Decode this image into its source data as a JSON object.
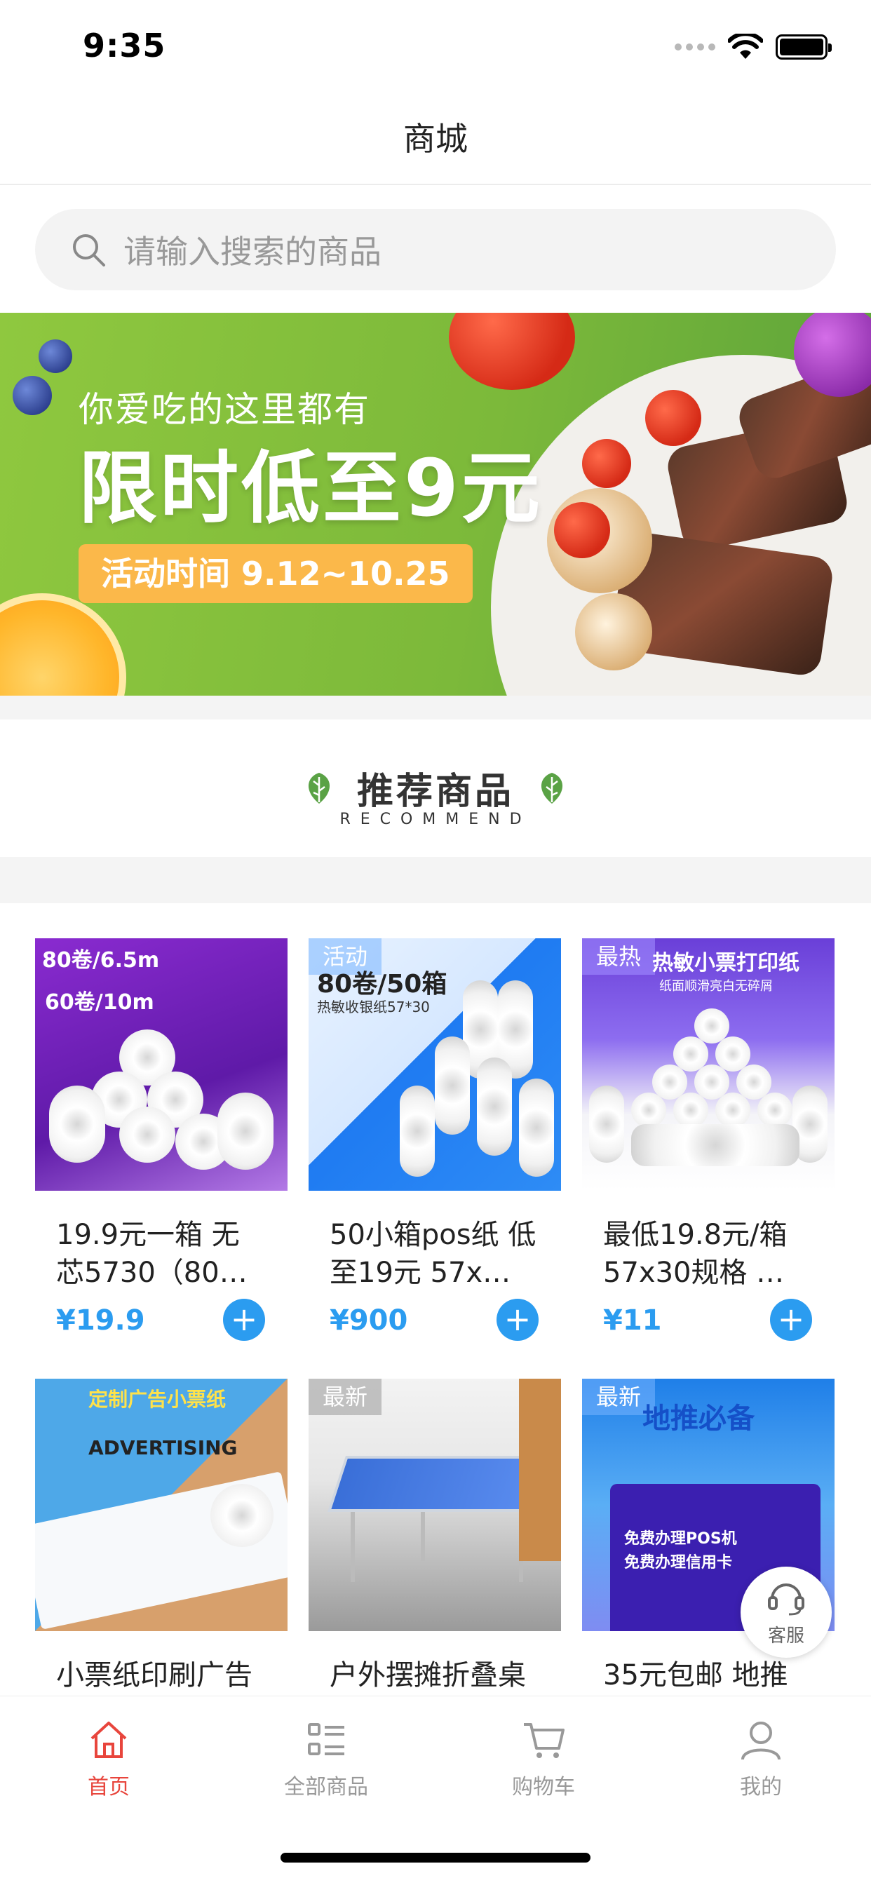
{
  "status_bar": {
    "time": "9:35"
  },
  "nav": {
    "title": "商城"
  },
  "search": {
    "placeholder": "请输入搜索的商品"
  },
  "banner": {
    "subtitle": "你爱吃的这里都有",
    "headline": "限时低至9元",
    "date_text": "活动时间 9.12~10.25"
  },
  "recommend": {
    "title": "推荐商品",
    "subtitle": "RECOMMEND"
  },
  "products": [
    {
      "name": "19.9元一箱 无芯5730（80…",
      "price": "¥19.9",
      "tag": "",
      "img_lines": [
        "80卷/6.5m",
        "60卷/10m"
      ]
    },
    {
      "name": "50小箱pos纸 低至19元 57x…",
      "price": "¥900",
      "tag": "活动",
      "img_lines": [
        "80卷/50箱",
        "热敏收银纸57*30"
      ]
    },
    {
      "name": "最低19.8元/箱 57x30规格 …",
      "price": "¥11",
      "tag": "最热",
      "img_lines": [
        "热敏小票打印纸",
        "纸面顺滑亮白无碎屑"
      ]
    },
    {
      "name": "小票纸印刷广告",
      "price": "",
      "tag": "",
      "img_lines": [
        "定制广告小票纸",
        "ADVERTISING"
      ]
    },
    {
      "name": "户外摆摊折叠桌",
      "price": "",
      "tag": "最新",
      "img_lines": []
    },
    {
      "name": "35元包邮 地推",
      "price": "",
      "tag": "最新",
      "img_lines": [
        "地推必备",
        "免费办理POS机",
        "免费办理信用卡"
      ]
    }
  ],
  "service": {
    "label": "客服"
  },
  "tabs": [
    {
      "label": "首页",
      "icon": "home-icon",
      "active": true
    },
    {
      "label": "全部商品",
      "icon": "list-icon",
      "active": false
    },
    {
      "label": "购物车",
      "icon": "cart-icon",
      "active": false
    },
    {
      "label": "我的",
      "icon": "user-icon",
      "active": false
    }
  ],
  "colors": {
    "accent": "#2b9cf0",
    "active_tab": "#e8453c",
    "banner_green": "#7cb93a",
    "date_badge": "#fbb84a"
  }
}
